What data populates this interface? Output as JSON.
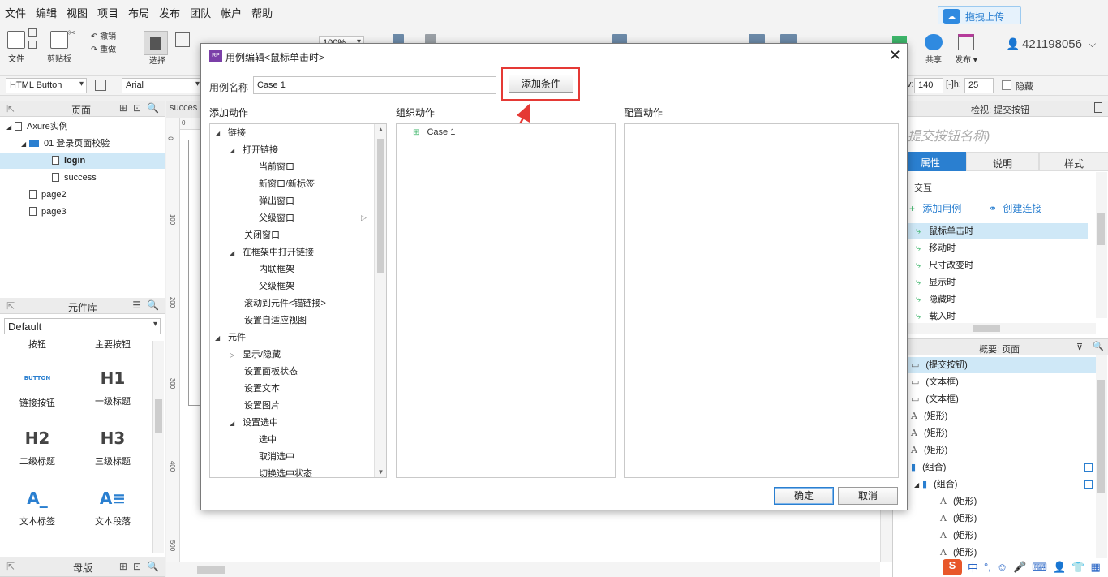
{
  "menubar": {
    "items": [
      "文件",
      "编辑",
      "视图",
      "项目",
      "布局",
      "发布",
      "团队",
      "帐户",
      "帮助"
    ]
  },
  "upload_button": "拖拽上传",
  "toolbar": {
    "file": "文件",
    "clipboard": "剪贴板",
    "undo": "撤销",
    "redo": "重做",
    "select": "选择",
    "zoom": "100%",
    "share": "共享",
    "publish": "发布 ▾",
    "user": "421198056"
  },
  "formatbar": {
    "widget_type": "HTML Button",
    "font": "Arial",
    "w_label": "v:",
    "w_value": "140",
    "h_label": "h:",
    "h_value": "25",
    "hidden_label": "隐藏"
  },
  "pages_panel": {
    "title": "页面",
    "tree": [
      {
        "label": "Axure实例",
        "depth": 0,
        "kind": "page",
        "expanded": true
      },
      {
        "label": "01 登录页面校验",
        "depth": 1,
        "kind": "folder",
        "expanded": true
      },
      {
        "label": "login",
        "depth": 2,
        "kind": "page",
        "selected": true
      },
      {
        "label": "success",
        "depth": 2,
        "kind": "page"
      },
      {
        "label": "page2",
        "depth": 1,
        "kind": "page"
      },
      {
        "label": "page3",
        "depth": 1,
        "kind": "page"
      }
    ]
  },
  "library_panel": {
    "title": "元件库",
    "library": "Default",
    "items": [
      {
        "glyph": "",
        "label": "按钮"
      },
      {
        "glyph": "",
        "label": "主要按钮"
      },
      {
        "glyph": "BUTTON",
        "label": "链接按钮"
      },
      {
        "glyph": "H1",
        "label": "一级标题"
      },
      {
        "glyph": "H2",
        "label": "二级标题"
      },
      {
        "glyph": "H3",
        "label": "三级标题"
      },
      {
        "glyph": "A_",
        "label": "文本标签"
      },
      {
        "glyph": "A≡",
        "label": "文本段落"
      }
    ]
  },
  "masters_panel": {
    "title": "母版"
  },
  "canvas": {
    "tab": "succes",
    "ruler_left": [
      "0",
      "100",
      "200",
      "300",
      "400",
      "500"
    ],
    "ruler_top": [
      "0"
    ]
  },
  "inspector": {
    "title": "检视: 提交按钮",
    "widget_name": "提交按钮名称)",
    "tabs": [
      "属性",
      "说明",
      "样式"
    ],
    "section": "交互",
    "add_case": "添加用例",
    "create_link": "创建连接",
    "events": [
      "鼠标单击时",
      "移动时",
      "尺寸改变时",
      "显示时",
      "隐藏时",
      "载入时"
    ]
  },
  "outline": {
    "title": "概要: 页面",
    "items": [
      {
        "label": "(提交按钮)",
        "icon": "button",
        "depth": 0,
        "selected": true
      },
      {
        "label": "(文本框)",
        "icon": "textbox",
        "depth": 0
      },
      {
        "label": "(文本框)",
        "icon": "textbox",
        "depth": 0
      },
      {
        "label": "(矩形)",
        "icon": "text",
        "depth": 0
      },
      {
        "label": "(矩形)",
        "icon": "text",
        "depth": 0
      },
      {
        "label": "(矩形)",
        "icon": "text",
        "depth": 0
      },
      {
        "label": "(组合)",
        "icon": "folder",
        "depth": 0
      },
      {
        "label": "(组合)",
        "icon": "folder",
        "depth": 1
      },
      {
        "label": "(矩形)",
        "icon": "text",
        "depth": 2
      },
      {
        "label": "(矩形)",
        "icon": "text",
        "depth": 2
      },
      {
        "label": "(矩形)",
        "icon": "text",
        "depth": 2
      },
      {
        "label": "(矩形)",
        "icon": "text",
        "depth": 2
      }
    ]
  },
  "dialog": {
    "title": "用例编辑<鼠标单击时>",
    "case_name_label": "用例名称",
    "case_name_value": "Case 1",
    "add_condition": "添加条件",
    "col_add": "添加动作",
    "col_organize": "组织动作",
    "col_configure": "配置动作",
    "actions": [
      {
        "label": "链接",
        "depth": 0,
        "toggle": "expanded"
      },
      {
        "label": "打开链接",
        "depth": 1,
        "toggle": "expanded"
      },
      {
        "label": "当前窗口",
        "depth": 2
      },
      {
        "label": "新窗口/新标签",
        "depth": 2
      },
      {
        "label": "弹出窗口",
        "depth": 2
      },
      {
        "label": "父级窗口",
        "depth": 2
      },
      {
        "label": "关闭窗口",
        "depth": 1
      },
      {
        "label": "在框架中打开链接",
        "depth": 1,
        "toggle": "expanded"
      },
      {
        "label": "内联框架",
        "depth": 2
      },
      {
        "label": "父级框架",
        "depth": 2
      },
      {
        "label": "滚动到元件<锚链接>",
        "depth": 1
      },
      {
        "label": "设置自适应视图",
        "depth": 1
      },
      {
        "label": "元件",
        "depth": 0,
        "toggle": "expanded"
      },
      {
        "label": "显示/隐藏",
        "depth": 1,
        "toggle": "collapsed"
      },
      {
        "label": "设置面板状态",
        "depth": 1
      },
      {
        "label": "设置文本",
        "depth": 1
      },
      {
        "label": "设置图片",
        "depth": 1
      },
      {
        "label": "设置选中",
        "depth": 1,
        "toggle": "expanded"
      },
      {
        "label": "选中",
        "depth": 2
      },
      {
        "label": "取消选中",
        "depth": 2
      },
      {
        "label": "切换选中状态",
        "depth": 2
      }
    ],
    "case_node": "Case 1",
    "ok": "确定",
    "cancel": "取消"
  },
  "tray": {
    "ime": "中"
  },
  "colors": {
    "accent": "#2a7fd0",
    "highlight": "#e53935",
    "selected": "#cfe8f7"
  }
}
